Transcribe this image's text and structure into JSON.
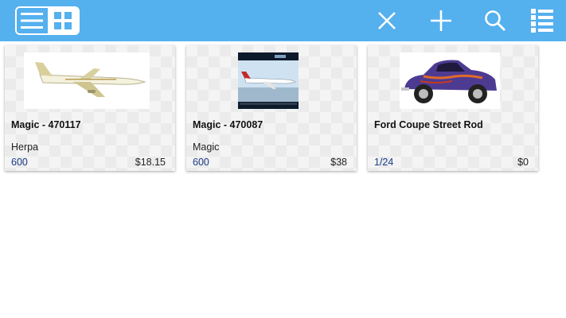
{
  "toolbar": {
    "color": "#55b0ee",
    "icons": [
      "list-view-icon",
      "grid-view-icon",
      "close-icon",
      "add-icon",
      "search-icon",
      "filter-list-icon"
    ]
  },
  "items": [
    {
      "title": "Magic - 470117",
      "brand": "Herpa",
      "scale": "600",
      "price": "$18.15",
      "image": "airliner-thumbnail"
    },
    {
      "title": "Magic - 470087",
      "brand": "Magic",
      "scale": "600",
      "price": "$38",
      "image": "airliner-box-thumbnail"
    },
    {
      "title": "Ford Coupe Street Rod",
      "brand": "",
      "scale": "1/24",
      "price": "$0",
      "image": "purple-coupe-thumbnail"
    }
  ]
}
